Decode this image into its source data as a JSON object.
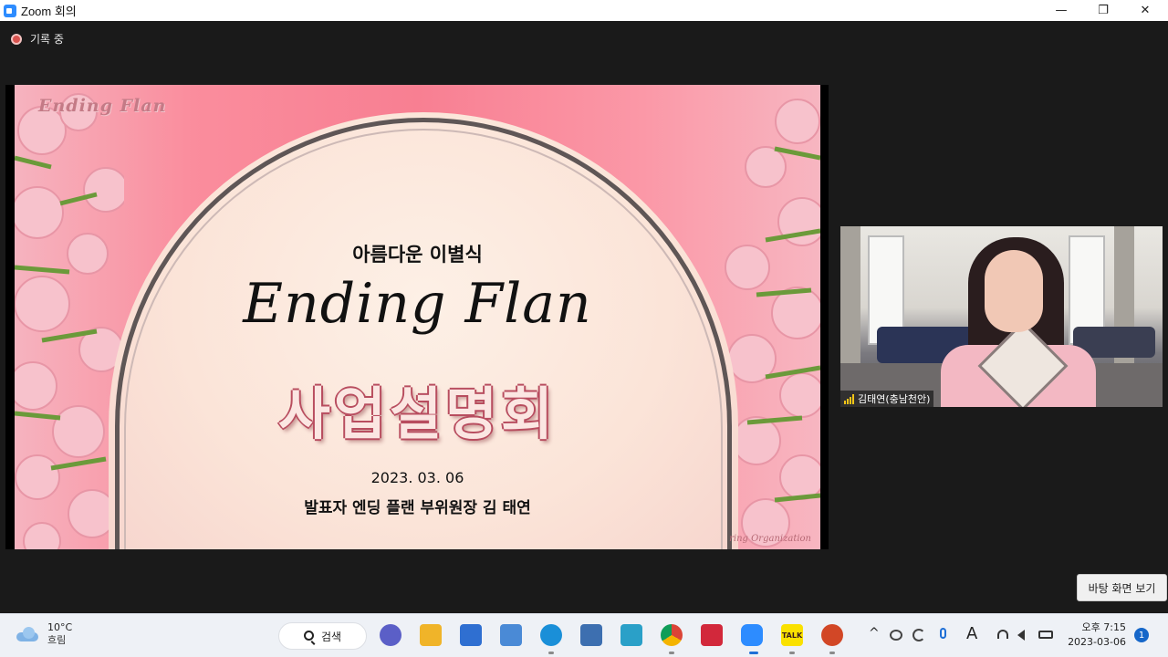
{
  "window": {
    "title": "Zoom 회의",
    "minimize": "—",
    "maximize": "❐",
    "close": "✕"
  },
  "recording": {
    "label": "기록 중"
  },
  "slide": {
    "logo": "Ending Flan",
    "subtitle": "아름다운 이별식",
    "script_title": "Ending Flan",
    "event": "사업설명회",
    "date": "2023. 03. 06",
    "presenter": "발표자  엔딩 플랜 부위원장 김 태연",
    "watermark": "ring Organization"
  },
  "participant": {
    "name": "김태연(충남천안)"
  },
  "desktop_popup": {
    "label": "바탕 화면 보기"
  },
  "taskbar": {
    "weather": {
      "temp": "10°C",
      "condition": "흐림"
    },
    "search_label": "검색",
    "apps": [
      {
        "name": "Chat",
        "color": "#5b5fc7"
      },
      {
        "name": "File Explorer",
        "color": "#f0b429"
      },
      {
        "name": "Microsoft Store",
        "color": "#2f6fd1"
      },
      {
        "name": "Settings",
        "color": "#4a8ad6"
      },
      {
        "name": "Edge",
        "color": "#1a8fd8"
      },
      {
        "name": "Network",
        "color": "#3d6fb0"
      },
      {
        "name": "Web App",
        "color": "#2aa0c8"
      },
      {
        "name": "Chrome",
        "color": "#db4437"
      },
      {
        "name": "Screen Capture",
        "color": "#d2283b"
      },
      {
        "name": "Zoom",
        "color": "#2d8cff"
      },
      {
        "name": "KakaoTalk",
        "color": "#fae100"
      },
      {
        "name": "PowerPoint",
        "color": "#d24726"
      }
    ],
    "kakao_label": "TALK",
    "tray": {
      "chevron": "^",
      "ime": "A",
      "time": "오후 7:15",
      "date": "2023-03-06",
      "notifications": "1"
    }
  }
}
